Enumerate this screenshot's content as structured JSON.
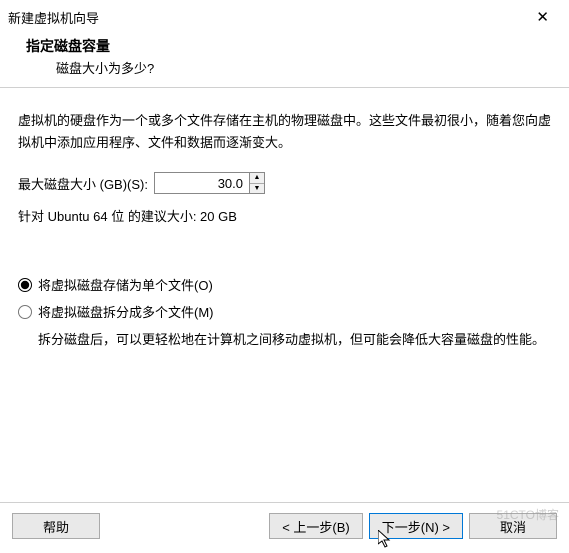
{
  "titlebar": {
    "title": "新建虚拟机向导"
  },
  "header": {
    "heading": "指定磁盘容量",
    "sub": "磁盘大小为多少?"
  },
  "content": {
    "description": "虚拟机的硬盘作为一个或多个文件存储在主机的物理磁盘中。这些文件最初很小，随着您向虚拟机中添加应用程序、文件和数据而逐渐变大。",
    "size_label": "最大磁盘大小 (GB)(S):",
    "size_value": "30.0",
    "recommend": "针对 Ubuntu 64 位 的建议大小: 20 GB",
    "radio_single": "将虚拟磁盘存储为单个文件(O)",
    "radio_split": "将虚拟磁盘拆分成多个文件(M)",
    "split_desc": "拆分磁盘后，可以更轻松地在计算机之间移动虚拟机，但可能会降低大容量磁盘的性能。"
  },
  "footer": {
    "help": "帮助",
    "back": "< 上一步(B)",
    "next": "下一步(N) >",
    "cancel": "取消"
  },
  "watermark": "51CTO博客"
}
